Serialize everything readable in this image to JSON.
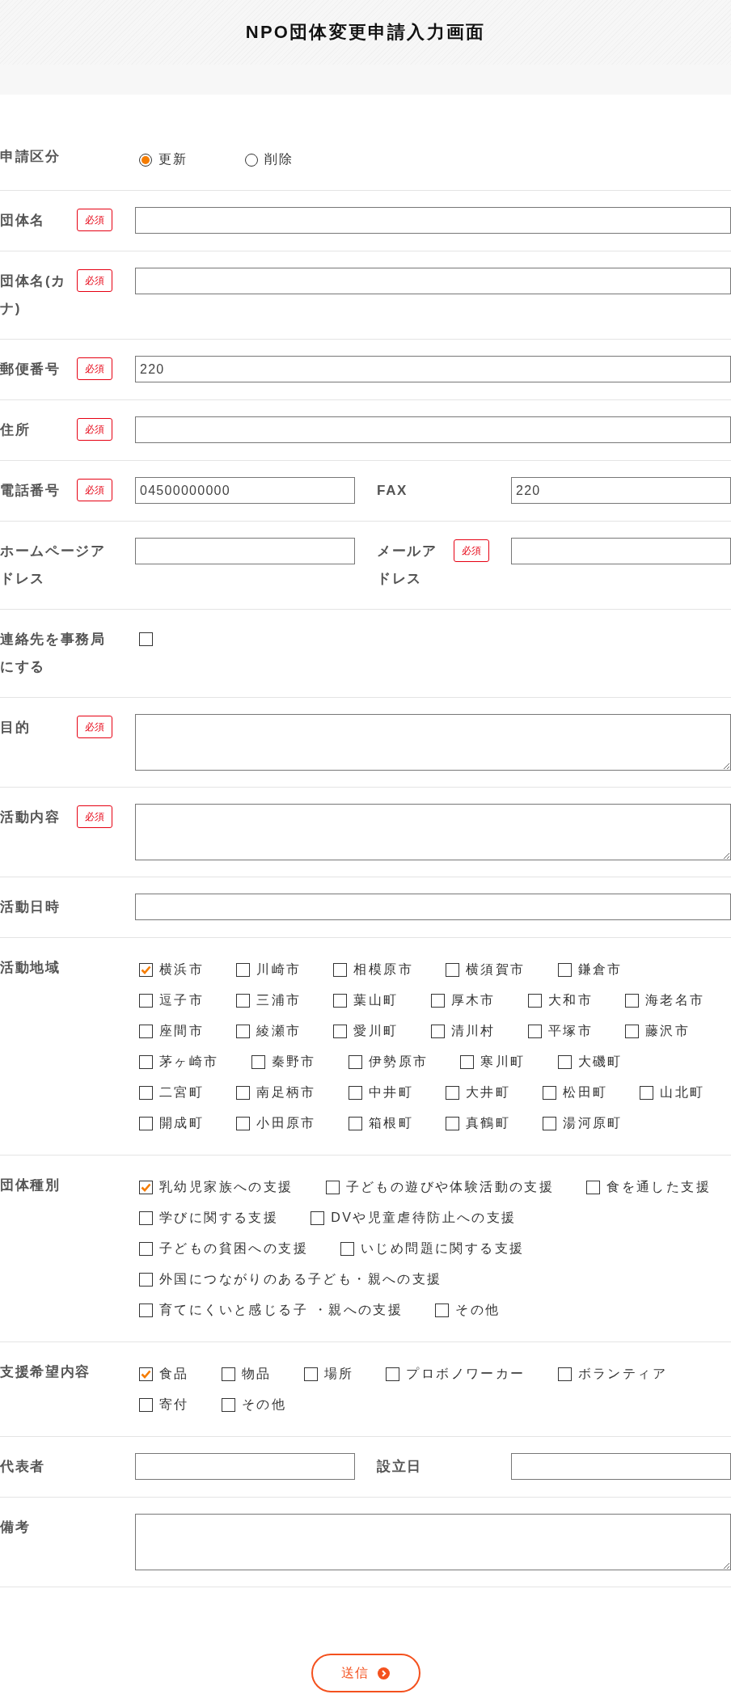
{
  "header": {
    "title": "NPO団体変更申請入力画面"
  },
  "rows": [
    {
      "kind": "radio",
      "label": "申請区分",
      "options": [
        {
          "label": "更新",
          "selected": true
        },
        {
          "label": "削除",
          "selected": false
        }
      ]
    },
    {
      "kind": "text",
      "label": "団体名",
      "badge": "必須"
    },
    {
      "kind": "text",
      "label": "団体名(カナ)",
      "badge": "必須"
    },
    {
      "kind": "text",
      "label": "郵便番号",
      "badge": "必須",
      "value": "220"
    },
    {
      "kind": "text",
      "label": "住所",
      "badge": "必須"
    },
    {
      "kind": "pair",
      "fields": [
        {
          "label": "電話番号",
          "badge": "必須",
          "value": "04500000000"
        },
        {
          "label": "FAX",
          "value": "220"
        }
      ]
    },
    {
      "kind": "pair",
      "fields": [
        {
          "label": "ホームページアドレス"
        },
        {
          "label": "メールアドレス",
          "badge": "必須"
        }
      ]
    },
    {
      "kind": "checkbox",
      "label": "連絡先を事務局にする",
      "checked": false
    },
    {
      "kind": "textarea",
      "label": "目的",
      "badge": "必須"
    },
    {
      "kind": "textarea",
      "label": "活動内容",
      "badge": "必須"
    },
    {
      "kind": "text",
      "label": "活動日時"
    },
    {
      "kind": "checkgroup",
      "label": "活動地域",
      "lines": [
        [
          {
            "label": "横浜市",
            "checked": true
          },
          {
            "label": "川崎市",
            "checked": false
          },
          {
            "label": "相模原市",
            "checked": false
          },
          {
            "label": "横須賀市",
            "checked": false
          },
          {
            "label": "鎌倉市",
            "checked": false
          }
        ],
        [
          {
            "label": "逗子市",
            "checked": false
          },
          {
            "label": "三浦市",
            "checked": false
          },
          {
            "label": "葉山町",
            "checked": false
          },
          {
            "label": "厚木市",
            "checked": false
          },
          {
            "label": "大和市",
            "checked": false
          },
          {
            "label": "海老名市",
            "checked": false
          }
        ],
        [
          {
            "label": "座間市",
            "checked": false
          },
          {
            "label": "綾瀬市",
            "checked": false
          },
          {
            "label": "愛川町",
            "checked": false
          },
          {
            "label": "清川村",
            "checked": false
          },
          {
            "label": "平塚市",
            "checked": false
          },
          {
            "label": "藤沢市",
            "checked": false
          }
        ],
        [
          {
            "label": "茅ヶ崎市",
            "checked": false
          },
          {
            "label": "秦野市",
            "checked": false
          },
          {
            "label": "伊勢原市",
            "checked": false
          },
          {
            "label": "寒川町",
            "checked": false
          },
          {
            "label": "大磯町",
            "checked": false
          }
        ],
        [
          {
            "label": "二宮町",
            "checked": false
          },
          {
            "label": "南足柄市",
            "checked": false
          },
          {
            "label": "中井町",
            "checked": false
          },
          {
            "label": "大井町",
            "checked": false
          },
          {
            "label": "松田町",
            "checked": false
          },
          {
            "label": "山北町",
            "checked": false
          }
        ],
        [
          {
            "label": "開成町",
            "checked": false
          },
          {
            "label": "小田原市",
            "checked": false
          },
          {
            "label": "箱根町",
            "checked": false
          },
          {
            "label": "真鶴町",
            "checked": false
          },
          {
            "label": "湯河原町",
            "checked": false
          }
        ]
      ]
    },
    {
      "kind": "checkgroup",
      "label": "団体種別",
      "lines": [
        [
          {
            "label": "乳幼児家族への支援",
            "checked": true
          },
          {
            "label": "子どもの遊びや体験活動の支援",
            "checked": false
          },
          {
            "label": "食を通した支援",
            "checked": false
          }
        ],
        [
          {
            "label": "学びに関する支援",
            "checked": false
          },
          {
            "label": "DVや児童虐待防止への支援",
            "checked": false
          }
        ],
        [
          {
            "label": "子どもの貧困への支援",
            "checked": false
          },
          {
            "label": "いじめ問題に関する支援",
            "checked": false
          }
        ],
        [
          {
            "label": "外国につながりのある子ども・親への支援",
            "checked": false
          }
        ],
        [
          {
            "label": "育てにくいと感じる子 ・親への支援",
            "checked": false
          },
          {
            "label": "その他",
            "checked": false
          }
        ]
      ]
    },
    {
      "kind": "checkgroup",
      "label": "支援希望内容",
      "lines": [
        [
          {
            "label": "食品",
            "checked": true
          },
          {
            "label": "物品",
            "checked": false
          },
          {
            "label": "場所",
            "checked": false
          },
          {
            "label": "プロボノワーカー",
            "checked": false
          },
          {
            "label": "ボランティア",
            "checked": false
          }
        ],
        [
          {
            "label": "寄付",
            "checked": false
          },
          {
            "label": "その他",
            "checked": false
          }
        ]
      ]
    },
    {
      "kind": "pair",
      "fields": [
        {
          "label": "代表者"
        },
        {
          "label": "設立日"
        }
      ]
    },
    {
      "kind": "textarea",
      "label": "備考"
    }
  ],
  "submit": {
    "label": "送信"
  }
}
